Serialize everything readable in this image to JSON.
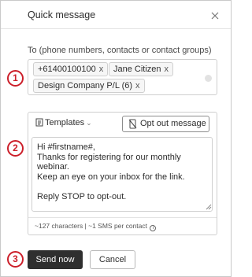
{
  "dialog": {
    "title": "Quick message"
  },
  "recipients": {
    "label": "To (phone numbers, contacts or contact groups)",
    "chips": [
      {
        "label": "+61400100100",
        "remove": "x"
      },
      {
        "label": "Jane Citizen",
        "remove": "x"
      },
      {
        "label": "Design Company P/L (6)",
        "remove": "x"
      }
    ]
  },
  "compose": {
    "templates_label": "Templates",
    "opt_out_label": "Opt out message",
    "message": "Hi #firstname#,\nThanks for registering for our monthly webinar.\nKeep an eye on your inbox for the link.\n\nReply STOP to opt-out.",
    "meta": "~127 characters | ~1 SMS per contact",
    "info_glyph": "i"
  },
  "annotations": [
    "1",
    "2",
    "3"
  ],
  "actions": {
    "send_label": "Send now",
    "cancel_label": "Cancel"
  },
  "colors": {
    "annotation": "#cc1f2a",
    "primary": "#2f2f2f"
  },
  "icons": {
    "close": "close-icon",
    "templates": "document-icon",
    "opt_out": "opt-out-icon",
    "info": "info-icon"
  }
}
